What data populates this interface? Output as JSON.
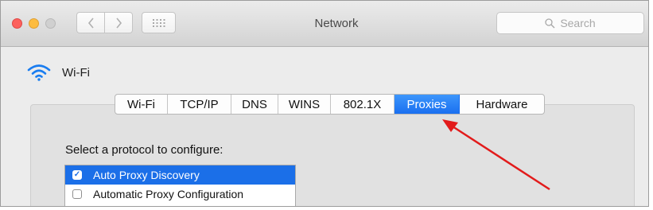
{
  "window": {
    "title": "Network",
    "search_placeholder": "Search"
  },
  "network": {
    "service_name": "Wi-Fi"
  },
  "tabs": [
    {
      "label": "Wi-Fi",
      "active": false
    },
    {
      "label": "TCP/IP",
      "active": false
    },
    {
      "label": "DNS",
      "active": false
    },
    {
      "label": "WINS",
      "active": false
    },
    {
      "label": "802.1X",
      "active": false
    },
    {
      "label": "Proxies",
      "active": true
    },
    {
      "label": "Hardware",
      "active": false
    }
  ],
  "proxies": {
    "select_label": "Select a protocol to configure:",
    "protocols": [
      {
        "label": "Auto Proxy Discovery",
        "checked": true,
        "selected": true
      },
      {
        "label": "Automatic Proxy Configuration",
        "checked": false,
        "selected": false
      }
    ]
  },
  "colors": {
    "accent": "#1b6fe8",
    "annotation_arrow": "#e21b1b",
    "wifi_icon": "#1a7df0"
  }
}
